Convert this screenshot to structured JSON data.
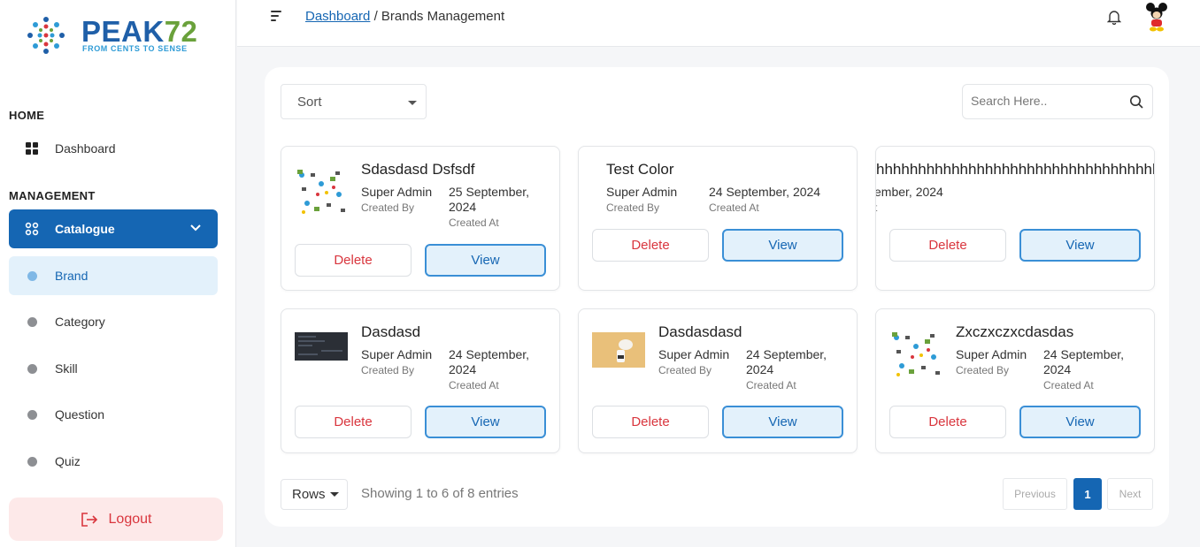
{
  "brand": {
    "name_main": "PEAK",
    "name_num": "72",
    "tagline": "FROM CENTS TO SENSE"
  },
  "sidebar": {
    "home_title": "HOME",
    "dashboard_label": "Dashboard",
    "management_title": "MANAGEMENT",
    "catalogue_label": "Catalogue",
    "items": [
      {
        "label": "Brand",
        "active": true
      },
      {
        "label": "Category"
      },
      {
        "label": "Skill"
      },
      {
        "label": "Question"
      },
      {
        "label": "Quiz"
      }
    ],
    "logout_label": "Logout"
  },
  "header": {
    "breadcrumb_link": "Dashboard",
    "breadcrumb_sep": "/",
    "breadcrumb_current": "Brands Management"
  },
  "toolbar": {
    "sort_label": "Sort",
    "search_placeholder": "Search Here.."
  },
  "cards": [
    {
      "title": "Sdasdasd Dsfsdf",
      "created_by": "Super Admin",
      "created_at": "25 September, 2024",
      "by_label": "Created By",
      "at_label": "Created At",
      "thumb": "collage"
    },
    {
      "title": "Test Color",
      "created_by": "Super Admin",
      "created_at": "24 September, 2024",
      "by_label": "Created By",
      "at_label": "Created At",
      "thumb": "none"
    },
    {
      "title": "hhhhhhhhhhhhhhhhhhhhhhhhhhhhhhhhhhh",
      "created_by": "",
      "created_at": "ember, 2024",
      "by_label": "",
      "at_label": "t",
      "thumb": "none"
    },
    {
      "title": "Dasdasd",
      "created_by": "Super Admin",
      "created_at": "24 September, 2024",
      "by_label": "Created By",
      "at_label": "Created At",
      "thumb": "dark"
    },
    {
      "title": "Dasdasdasd",
      "created_by": "Super Admin",
      "created_at": "24 September, 2024",
      "by_label": "Created By",
      "at_label": "Created At",
      "thumb": "photo"
    },
    {
      "title": "Zxczxczxcdasdas",
      "created_by": "Super Admin",
      "created_at": "24 September, 2024",
      "by_label": "Created By",
      "at_label": "Created At",
      "thumb": "collage"
    }
  ],
  "actions": {
    "delete_label": "Delete",
    "view_label": "View"
  },
  "footer": {
    "rows_label": "Rows",
    "showing_text": "Showing 1 to 6 of 8 entries",
    "prev_label": "Previous",
    "current_page": "1",
    "next_label": "Next"
  },
  "colors": {
    "primary": "#1566b3",
    "danger": "#d9363e",
    "active_bg": "#e3f1fb"
  }
}
